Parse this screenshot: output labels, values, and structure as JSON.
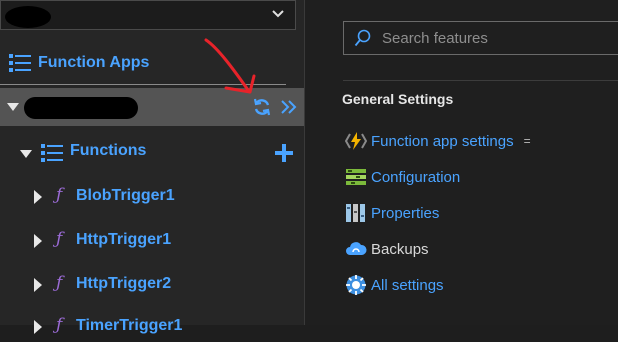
{
  "sidebar": {
    "function_apps_label": "Function Apps",
    "functions_label": "Functions",
    "functions": [
      {
        "name": "BlobTrigger1"
      },
      {
        "name": "HttpTrigger1"
      },
      {
        "name": "HttpTrigger2"
      },
      {
        "name": "TimerTrigger1"
      }
    ]
  },
  "search": {
    "placeholder": "Search features"
  },
  "general_settings": {
    "title": "General Settings",
    "items": [
      {
        "label": "Function app settings",
        "badge": "="
      },
      {
        "label": "Configuration"
      },
      {
        "label": "Properties"
      },
      {
        "label": "Backups"
      },
      {
        "label": "All settings"
      }
    ]
  },
  "colors": {
    "accent": "#4aa3ff",
    "function_glyph": "#9b6bd6",
    "annotation": "#e8232a"
  }
}
